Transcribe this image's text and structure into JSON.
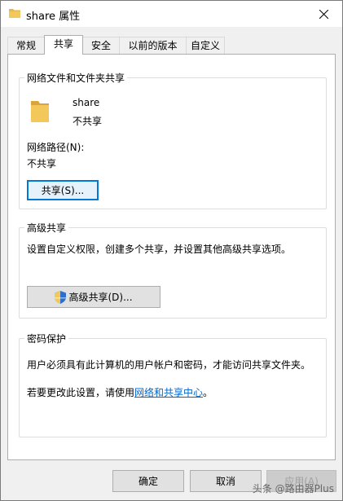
{
  "window": {
    "title": "share 属性"
  },
  "tabs": [
    {
      "label": "常规"
    },
    {
      "label": "共享"
    },
    {
      "label": "安全"
    },
    {
      "label": "以前的版本"
    },
    {
      "label": "自定义"
    }
  ],
  "network_share": {
    "group_title": "网络文件和文件夹共享",
    "folder_name": "share",
    "share_status": "不共享",
    "path_label": "网络路径(N):",
    "path_value": "不共享",
    "share_button": "共享(S)..."
  },
  "advanced_share": {
    "group_title": "高级共享",
    "description": "设置自定义权限，创建多个共享，并设置其他高级共享选项。",
    "button": "高级共享(D)..."
  },
  "password_protection": {
    "group_title": "密码保护",
    "description": "用户必须具有此计算机的用户帐户和密码，才能访问共享文件夹。",
    "change_prefix": "若要更改此设置，请使用",
    "change_link": "网络和共享中心",
    "change_suffix": "。"
  },
  "footer": {
    "ok": "确定",
    "cancel": "取消",
    "apply": "应用(A)"
  },
  "watermark": "头条 @路由器Plus",
  "colors": {
    "accent": "#0078d7",
    "link": "#0066cc",
    "folder": "#e8b74a"
  }
}
